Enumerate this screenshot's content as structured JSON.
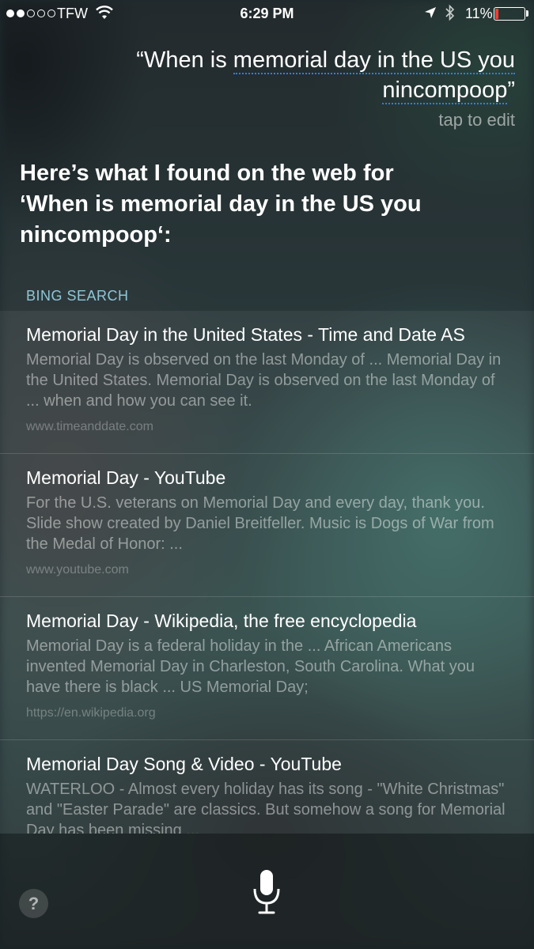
{
  "status_bar": {
    "carrier": "TFW",
    "time": "6:29 PM",
    "battery": "11%",
    "battery_level": 0.11,
    "signal_bars": 2,
    "signal_total": 5,
    "icons": [
      "wifi-icon",
      "location-arrow-icon",
      "bluetooth-icon",
      "battery-icon"
    ]
  },
  "query": {
    "open_quote": "“",
    "prefix": "When is ",
    "underlined_1": "memorial day in the US you",
    "underlined_2": "nincompoop",
    "close_quote": "”",
    "tap_to_edit": "tap to edit",
    "underline_color": "#2f7fe0"
  },
  "answer": {
    "line1": "Here’s what I found on the web for",
    "line2": "‘When is memorial day in the US you",
    "line3": "nincompoop‘:"
  },
  "section_label": "BING SEARCH",
  "results": [
    {
      "title": "Memorial Day in the United States - Time and Date AS",
      "snippet": "Memorial Day is observed on the last Monday of ... Memorial Day in the United States. Memorial Day is observed on the last Monday of ... when and how you can see it.",
      "url": "www.timeanddate.com"
    },
    {
      "title": "Memorial Day - YouTube",
      "snippet": "For the U.S. veterans on Memorial Day and every day, thank you. Slide show created by Daniel Breitfeller. Music is Dogs of War from the Medal of Honor: ...",
      "url": "www.youtube.com"
    },
    {
      "title": "Memorial Day - Wikipedia, the free encyclopedia",
      "snippet": "Memorial Day is a federal holiday in the ... African Americans invented Memorial Day in Charleston, South Carolina. What you have there is black ... US Memorial Day;",
      "url": "https://en.wikipedia.org"
    },
    {
      "title": "Memorial Day Song & Video - YouTube",
      "snippet": "WATERLOO - Almost every holiday has its song - \"White Christmas\" and \"Easter Parade\" are classics. But somehow a song for Memorial Day has been missing ...",
      "url": ""
    }
  ],
  "bottom": {
    "help_label": "?",
    "mic_icon": "microphone-icon"
  },
  "colors": {
    "accent_label": "#8fc6d8",
    "battery_low": "#ff3b30"
  }
}
